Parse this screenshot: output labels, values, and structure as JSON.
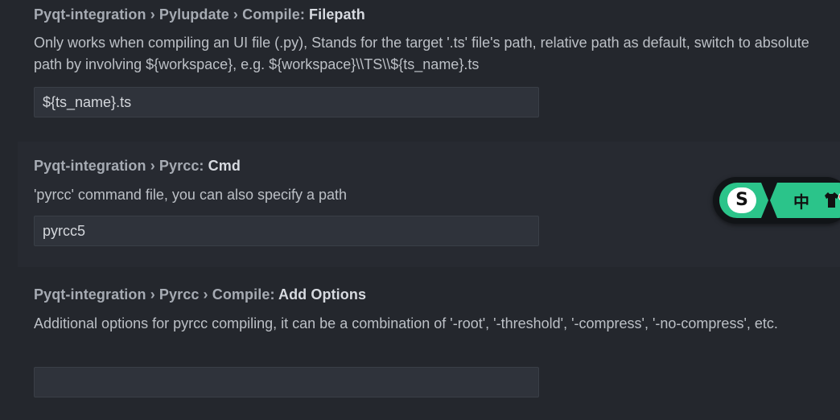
{
  "settings": [
    {
      "prefix": "Pyqt-integration › Pylupdate › Compile: ",
      "key": "Filepath",
      "description": "Only works when compiling an UI file (.py), Stands for the target '.ts' file's path, relative path as default, switch to absolute path by involving ${workspace}, e.g. ${workspace}\\\\TS\\\\${ts_name}.ts",
      "value": "${ts_name}.ts"
    },
    {
      "prefix": "Pyqt-integration › Pyrcc: ",
      "key": "Cmd",
      "description": "'pyrcc' command file, you can also specify a path",
      "value": "pyrcc5"
    },
    {
      "prefix": "Pyqt-integration › Pyrcc › Compile: ",
      "key": "Add Options",
      "description": "Additional options for pyrcc compiling, it can be a combination of '-root', '-threshold', '-compress', '-no-compress', etc.",
      "value": ""
    }
  ],
  "ime": {
    "logo": "S",
    "language": "中",
    "icon": "shirt-icon",
    "accent": "#2bc48a",
    "dot_color": "#e8403b"
  }
}
